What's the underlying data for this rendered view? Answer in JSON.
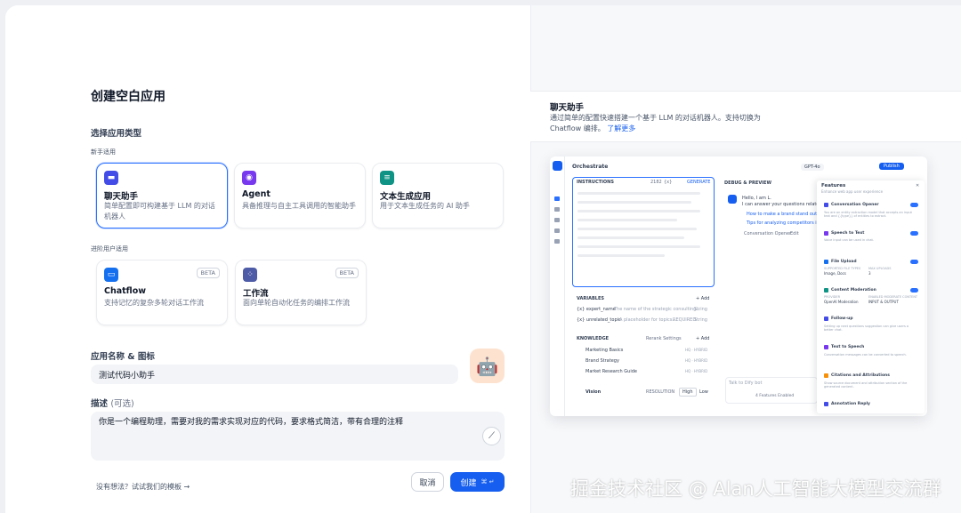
{
  "title": "创建空白应用",
  "choose_type": "选择应用类型",
  "beginner": "新手适用",
  "advanced": "进阶用户适用",
  "cards": [
    {
      "name": "聊天助手",
      "desc": "简单配置即可构建基于 LLM 的对话机器人",
      "color": "#444ce7",
      "icon": "chat-bubble-icon"
    },
    {
      "name": "Agent",
      "desc": "具备推理与自主工具调用的智能助手",
      "color": "#7839ee",
      "icon": "robot-icon"
    },
    {
      "name": "文本生成应用",
      "desc": "用于文本生成任务的 AI 助手",
      "color": "#0e9384",
      "icon": "text-gen-icon"
    },
    {
      "name": "Chatflow",
      "desc": "支持记忆的复杂多轮对话工作流",
      "badge": "BETA",
      "color": "#1570ef",
      "icon": "chatflow-icon"
    },
    {
      "name": "工作流",
      "desc": "面向单轮自动化任务的编排工作流",
      "badge": "BETA",
      "color": "#4e5ba6",
      "icon": "workflow-icon"
    }
  ],
  "name_label": "应用名称 & 图标",
  "name_value": "测试代码小助手",
  "desc_label": "描述",
  "desc_optional": "(可选)",
  "desc_value": "你是一个编程助理，需要对我的需求实现对应的代码，要求格式简洁，带有合理的注释",
  "no_idea": "没有想法？试试我们的模板",
  "cancel": "取消",
  "create": "创建",
  "create_shortcut": "⌘ ↵",
  "preview": {
    "heading": "聊天助手",
    "desc": "通过简单的配置快速搭建一个基于 LLM 的对话机器人。支持切换为 Chatflow 编排。",
    "more": "了解更多"
  },
  "mock": {
    "orchestrate": "Orchestrate",
    "model": "GPT-4o",
    "publish": "Publish",
    "instructions": "INSTRUCTIONS",
    "tokens": "2182",
    "var": "{x}",
    "generate": "GENERATE",
    "variables": "VARIABLES",
    "add": "+ Add",
    "var1_name": "{x} expert_name",
    "var1_desc": "The name of the strategic consulting...",
    "var1_type": "String",
    "var2_name": "{x} unrelated_topic",
    "var2_desc": "A placeholder for topics...",
    "var2_req": "REQUIRED",
    "var2_type": "String",
    "knowledge": "KNOWLEDGE",
    "rerank": "Rerank Settings",
    "k1": "Marketing Basics",
    "k2": "Brand Strategy",
    "k3": "Market Research Guide",
    "ktag": "HQ · HYBRID",
    "vision": "Vision",
    "resolution": "RESOLUTION",
    "high": "High",
    "low": "Low",
    "debug": "DEBUG & PREVIEW",
    "hello1": "Hello, I am L.",
    "hello2": "I can answer your questions related",
    "link1": "How to make a brand stand out?",
    "link2": "Tips for analyzing competitors in marketing",
    "opener": "Conversation Opener",
    "edit": "Edit",
    "talk": "Talk to Dify bot",
    "features_enabled": "4 Features Enabled",
    "features": "Features",
    "features_sub": "Enhance web app user experience",
    "f1": "Conversation Opener",
    "f1d": "You are an entity extraction model that accepts an input text and {{type}} of entities to extract.",
    "f2": "Speech to Text",
    "f2d": "Voice input can be used in chat.",
    "f3": "File Upload",
    "f3a": "SUPPORTED FILE TYPES",
    "f3b": "Image, Docs",
    "f3c": "MAX UPLOADS",
    "f3d": "3",
    "f4": "Content Moderation",
    "f4a": "PROVIDER",
    "f4b": "OpenAI Moderation",
    "f4c": "ENABLED MODERATE CONTENT",
    "f4d": "INPUT & OUTPUT",
    "f5": "Follow-up",
    "f5d": "Setting up next questions suggestion can give users a better chat.",
    "f6": "Text to Speech",
    "f6d": "Conversation messages can be converted to speech.",
    "f7": "Citations and Attributions",
    "f7d": "Show source document and attribution section of the generated content.",
    "f8": "Annotation Reply"
  },
  "watermark": "掘金技术社区 @ Alan人工智能大模型交流群"
}
